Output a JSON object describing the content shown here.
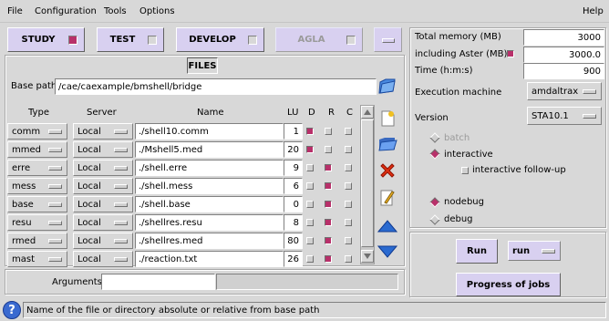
{
  "menubar": {
    "file": "File",
    "configuration": "Configuration",
    "tools": "Tools",
    "options": "Options",
    "help": "Help"
  },
  "modes": [
    {
      "label": "STUDY",
      "active": true
    },
    {
      "label": "TEST",
      "active": false
    },
    {
      "label": "DEVELOP",
      "active": false
    },
    {
      "label": "AGLA",
      "active": false,
      "disabled": true
    }
  ],
  "files": {
    "title": "FILES",
    "base_path_label": "Base path",
    "base_path": "/cae/caexample/bmshell/bridge",
    "headers": {
      "type": "Type",
      "server": "Server",
      "name": "Name",
      "lu": "LU",
      "d": "D",
      "r": "R",
      "c": "C"
    },
    "rows": [
      {
        "type": "comm",
        "server": "Local",
        "name": "./shell10.comm",
        "lu": "1",
        "d": true,
        "r": false,
        "c": false
      },
      {
        "type": "mmed",
        "server": "Local",
        "name": "./Mshell5.med",
        "lu": "20",
        "d": true,
        "r": false,
        "c": false
      },
      {
        "type": "erre",
        "server": "Local",
        "name": "./shell.erre",
        "lu": "9",
        "d": false,
        "r": true,
        "c": false
      },
      {
        "type": "mess",
        "server": "Local",
        "name": "./shell.mess",
        "lu": "6",
        "d": false,
        "r": true,
        "c": false
      },
      {
        "type": "base",
        "server": "Local",
        "name": "./shell.base",
        "lu": "0",
        "d": false,
        "r": true,
        "c": false
      },
      {
        "type": "resu",
        "server": "Local",
        "name": "./shellres.resu",
        "lu": "8",
        "d": false,
        "r": true,
        "c": false
      },
      {
        "type": "rmed",
        "server": "Local",
        "name": "./shellres.med",
        "lu": "80",
        "d": false,
        "r": true,
        "c": false
      },
      {
        "type": "mast",
        "server": "Local",
        "name": "./reaction.txt",
        "lu": "26",
        "d": false,
        "r": true,
        "c": false
      }
    ],
    "arguments_label": "Arguments",
    "arguments_value": ""
  },
  "settings": {
    "total_memory_label": "Total memory (MB)",
    "total_memory": "3000",
    "aster_label": "including Aster (MB)",
    "aster_memory": "3000.0",
    "time_label": "Time (h:m:s)",
    "time": "900",
    "exec_machine_label": "Execution machine",
    "exec_machine": "amdaltrax",
    "version_label": "Version",
    "version": "STA10.1",
    "batch": "batch",
    "interactive": "interactive",
    "interactive_followup": "interactive follow-up",
    "nodebug": "nodebug",
    "debug": "debug"
  },
  "actions": {
    "run": "Run",
    "run_mode": "run",
    "progress": "Progress of jobs"
  },
  "status": {
    "message": "Name of the file or directory absolute or relative from base path"
  },
  "colors": {
    "accent": "#b8306a",
    "lavender": "#d8d0f0",
    "folder": "#3a7ad8"
  }
}
